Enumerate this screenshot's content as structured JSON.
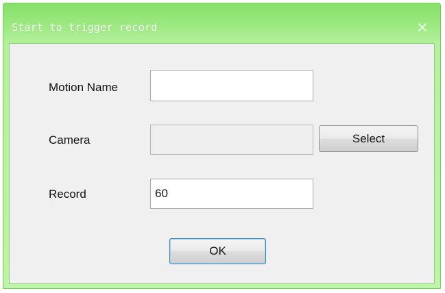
{
  "window": {
    "title": "Start to trigger record",
    "close_icon": "close-icon"
  },
  "form": {
    "motion_name_label": "Motion Name",
    "motion_name_value": "",
    "camera_label": "Camera",
    "camera_value": "",
    "select_button": "Select",
    "record_label": "Record",
    "record_value": "60",
    "ok_button": "OK"
  },
  "colors": {
    "title_bar": "#9ae97f",
    "title_text": "#ffffff",
    "client_background": "#f0f0f0",
    "default_button_border": "#3c7fb1"
  }
}
